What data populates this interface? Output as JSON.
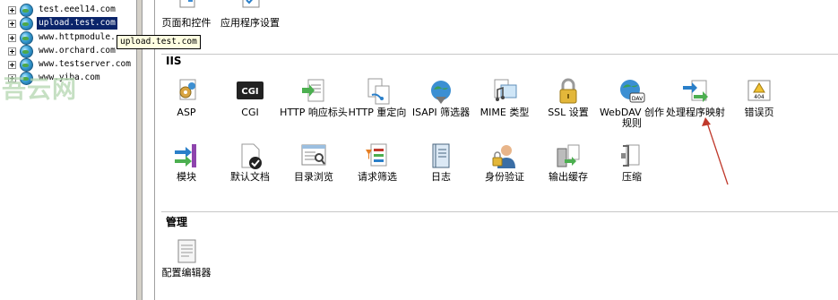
{
  "tree": {
    "sites": [
      {
        "label": "test.eeel14.com",
        "selected": false
      },
      {
        "label": "upload.test.com",
        "selected": true
      },
      {
        "label": "www.httpmodule.",
        "selected": false
      },
      {
        "label": "www.orchard.com",
        "selected": false
      },
      {
        "label": "www.testserver.com",
        "selected": false
      },
      {
        "label": "www.yiba.com",
        "selected": false
      }
    ],
    "tooltip": "upload.test.com"
  },
  "watermark": "吾云网",
  "top_row": [
    {
      "label": "页面和控件",
      "icon": "page-controls-icon"
    },
    {
      "label": "应用程序设置",
      "icon": "app-settings-icon"
    }
  ],
  "sections": {
    "iis": {
      "title": "IIS"
    },
    "manage": {
      "title": "管理"
    }
  },
  "iis_row1": [
    {
      "label": "ASP",
      "icon": "asp-icon"
    },
    {
      "label": "CGI",
      "icon": "cgi-icon"
    },
    {
      "label": "HTTP 响应标头",
      "icon": "http-response-headers-icon"
    },
    {
      "label": "HTTP 重定向",
      "icon": "http-redirect-icon"
    },
    {
      "label": "ISAPI 筛选器",
      "icon": "isapi-filters-icon"
    },
    {
      "label": "MIME 类型",
      "icon": "mime-types-icon"
    },
    {
      "label": "SSL 设置",
      "icon": "ssl-lock-icon"
    },
    {
      "label": "WebDAV 创作规则",
      "icon": "webdav-icon"
    },
    {
      "label": "处理程序映射",
      "icon": "handler-mappings-icon"
    },
    {
      "label": "错误页",
      "icon": "error-pages-icon"
    }
  ],
  "iis_row2": [
    {
      "label": "模块",
      "icon": "modules-icon"
    },
    {
      "label": "默认文档",
      "icon": "default-document-icon"
    },
    {
      "label": "目录浏览",
      "icon": "directory-browsing-icon"
    },
    {
      "label": "请求筛选",
      "icon": "request-filtering-icon"
    },
    {
      "label": "日志",
      "icon": "logging-icon"
    },
    {
      "label": "身份验证",
      "icon": "authentication-icon"
    },
    {
      "label": "输出缓存",
      "icon": "output-caching-icon"
    },
    {
      "label": "压缩",
      "icon": "compression-icon"
    }
  ],
  "manage_row": [
    {
      "label": "配置编辑器",
      "icon": "config-editor-icon"
    }
  ],
  "colors": {
    "selection": "#0a246a",
    "arrow": "#c0392b",
    "tooltip_bg": "#ffffe1"
  }
}
